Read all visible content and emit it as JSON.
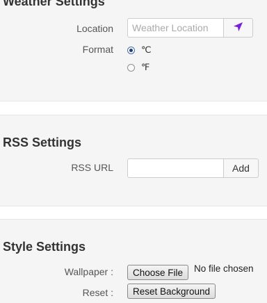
{
  "weather": {
    "title": "Weather Settings",
    "location_label": "Location",
    "location_placeholder": "Weather Location",
    "location_value": "",
    "locate_icon": "location-arrow-icon",
    "format_label": "Format",
    "format_options": [
      {
        "label": "℃",
        "checked": true
      },
      {
        "label": "℉",
        "checked": false
      }
    ]
  },
  "rss": {
    "title": "RSS Settings",
    "url_label": "RSS URL",
    "url_value": "",
    "add_label": "Add"
  },
  "style": {
    "title": "Style Settings",
    "wallpaper_label": "Wallpaper :",
    "choose_file_label": "Choose File",
    "no_file_text": "No file chosen",
    "reset_label": "Reset :",
    "reset_button_label": "Reset Background"
  },
  "colors": {
    "panel_bg": "#f5f5f5",
    "locate_icon_color": "#7a1fd6"
  }
}
